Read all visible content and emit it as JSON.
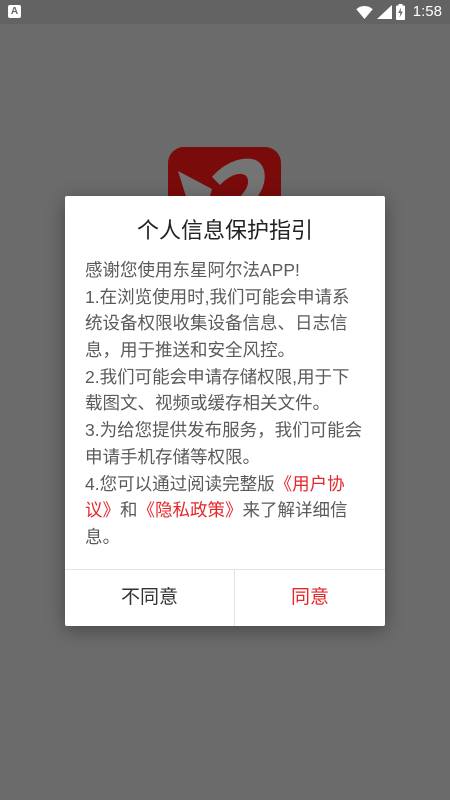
{
  "status_bar": {
    "time": "1:58",
    "notification_icon_label": "A",
    "icons": [
      "notification-icon",
      "wifi-icon",
      "signal-icon",
      "battery-icon"
    ]
  },
  "background_app": {
    "icon": "app-logo-icon",
    "icon_color": "#7a0b0b"
  },
  "dialog": {
    "title": "个人信息保护指引",
    "body_lines": [
      [
        {
          "text": "感谢您使用东星阿尔法APP!"
        }
      ],
      [
        {
          "text": "1.在浏览使用时,我们可能会申请系"
        }
      ],
      [
        {
          "text": "统设备权限收集设备信息、日志信"
        }
      ],
      [
        {
          "text": "息，用于推送和安全风控。"
        }
      ],
      [
        {
          "text": "2.我们可能会申请存储权限,用于下"
        }
      ],
      [
        {
          "text": "载图文、视频或缓存相关文件。"
        }
      ],
      [
        {
          "text": "3.为给您提供发布服务，我们可能会"
        }
      ],
      [
        {
          "text": "申请手机存储等权限。"
        }
      ],
      [
        {
          "text": "4.您可以通过阅读完整版"
        },
        {
          "text": "《用户协",
          "link": true
        }
      ],
      [
        {
          "text": "议》",
          "link": true
        },
        {
          "text": "和"
        },
        {
          "text": "《隐私政策》",
          "link": true
        },
        {
          "text": "来了解详细信"
        }
      ],
      [
        {
          "text": "息。"
        }
      ]
    ],
    "decline_label": "不同意",
    "accept_label": "同意"
  },
  "colors": {
    "accent": "#e5262b",
    "title_text": "#222222",
    "body_text": "#5a5a5a",
    "scrim_background": "#6b6b6b"
  }
}
